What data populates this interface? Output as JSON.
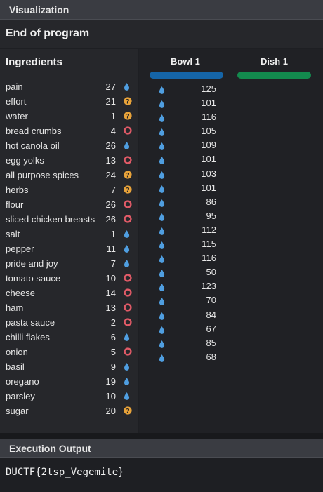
{
  "panel_title": "Visualization",
  "status": "End of program",
  "ingredients": {
    "title": "Ingredients",
    "items": [
      {
        "name": "pain",
        "qty": "27",
        "icon": "liquid-drop-icon"
      },
      {
        "name": "effort",
        "qty": "21",
        "icon": "unknown-icon"
      },
      {
        "name": "water",
        "qty": "1",
        "icon": "unknown-icon"
      },
      {
        "name": "bread crumbs",
        "qty": "4",
        "icon": "dry-ring-icon"
      },
      {
        "name": "hot canola oil",
        "qty": "26",
        "icon": "liquid-drop-icon"
      },
      {
        "name": "egg yolks",
        "qty": "13",
        "icon": "dry-ring-icon"
      },
      {
        "name": "all purpose spices",
        "qty": "24",
        "icon": "unknown-icon"
      },
      {
        "name": "herbs",
        "qty": "7",
        "icon": "unknown-icon"
      },
      {
        "name": "flour",
        "qty": "26",
        "icon": "dry-ring-icon"
      },
      {
        "name": "sliced chicken breasts",
        "qty": "26",
        "icon": "dry-ring-icon"
      },
      {
        "name": "salt",
        "qty": "1",
        "icon": "liquid-drop-icon"
      },
      {
        "name": "pepper",
        "qty": "11",
        "icon": "liquid-drop-icon"
      },
      {
        "name": "pride and joy",
        "qty": "7",
        "icon": "liquid-drop-icon"
      },
      {
        "name": "tomato sauce",
        "qty": "10",
        "icon": "dry-ring-icon"
      },
      {
        "name": "cheese",
        "qty": "14",
        "icon": "dry-ring-icon"
      },
      {
        "name": "ham",
        "qty": "13",
        "icon": "dry-ring-icon"
      },
      {
        "name": "pasta sauce",
        "qty": "2",
        "icon": "dry-ring-icon"
      },
      {
        "name": "chilli flakes",
        "qty": "6",
        "icon": "liquid-drop-icon"
      },
      {
        "name": "onion",
        "qty": "5",
        "icon": "dry-ring-icon"
      },
      {
        "name": "basil",
        "qty": "9",
        "icon": "liquid-drop-icon"
      },
      {
        "name": "oregano",
        "qty": "19",
        "icon": "liquid-drop-icon"
      },
      {
        "name": "parsley",
        "qty": "10",
        "icon": "liquid-drop-icon"
      },
      {
        "name": "sugar",
        "qty": "20",
        "icon": "unknown-icon"
      }
    ]
  },
  "bowls": [
    {
      "label": "Bowl 1",
      "color": "#1565a8",
      "values": [
        "125",
        "101",
        "116",
        "105",
        "109",
        "101",
        "103",
        "101",
        "86",
        "95",
        "112",
        "115",
        "116",
        "50",
        "123",
        "70",
        "84",
        "67",
        "85",
        "68"
      ]
    },
    {
      "label": "Dish 1",
      "color": "#138a4e",
      "values": []
    }
  ],
  "execution": {
    "title": "Execution Output",
    "output": "DUCTF{2tsp_Vegemite}"
  },
  "colors": {
    "liquid": "#4f9ee0",
    "unknown": "#e8a33a",
    "dry": "#e05a67"
  }
}
